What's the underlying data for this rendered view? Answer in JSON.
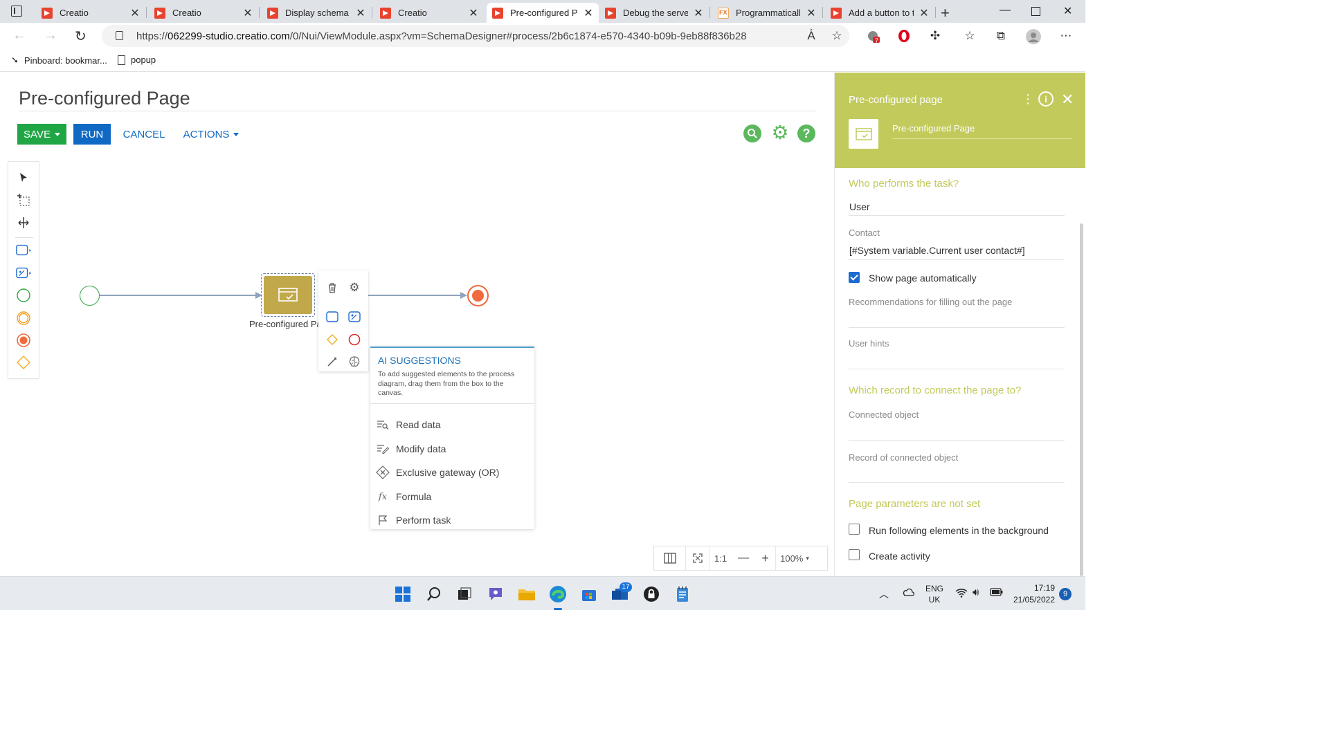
{
  "browser": {
    "tabs": [
      {
        "title": "Creatio",
        "icon": "creatio-favicon"
      },
      {
        "title": "Creatio",
        "icon": "creatio-favicon"
      },
      {
        "title": "Display schema -",
        "icon": "creatio-favicon"
      },
      {
        "title": "Creatio",
        "icon": "creatio-favicon"
      },
      {
        "title": "Pre-configured Pa",
        "icon": "creatio-favicon",
        "active": true
      },
      {
        "title": "Debug the server",
        "icon": "creatio-favicon"
      },
      {
        "title": "Programmatically",
        "icon": "fx-favicon"
      },
      {
        "title": "Add a button to t",
        "icon": "creatio-favicon"
      }
    ],
    "fx_letters": "FX",
    "url_prefix": "https://",
    "url_host": "062299-studio.creatio.com",
    "url_path": "/0/Nui/ViewModule.aspx?vm=SchemaDesigner#process/2b6c1874-e570-4340-b09b-9eb88f836b28",
    "extension_badge": "7",
    "bookmarks": [
      {
        "label": "Pinboard: bookmar...",
        "icon": "pin-icon"
      },
      {
        "label": "popup",
        "icon": "page-icon"
      }
    ]
  },
  "page": {
    "title": "Pre-configured Page",
    "toolbar": {
      "save_label": "SAVE",
      "run_label": "RUN",
      "cancel_label": "CANCEL",
      "actions_label": "ACTIONS"
    }
  },
  "canvas": {
    "task_label": "Pre-configured Page",
    "ai": {
      "title": "AI SUGGESTIONS",
      "description": "To add suggested elements to the process diagram, drag them from the box to the canvas.",
      "items": [
        {
          "label": "Read data",
          "icon": "read-data-icon"
        },
        {
          "label": "Modify data",
          "icon": "modify-data-icon"
        },
        {
          "label": "Exclusive gateway (OR)",
          "icon": "exclusive-gateway-icon"
        },
        {
          "label": "Formula",
          "icon": "formula-icon"
        },
        {
          "label": "Perform task",
          "icon": "flag-icon"
        }
      ]
    },
    "zoom": {
      "one_to_one": "1:1",
      "minus": "—",
      "plus": "+",
      "level": "100%"
    }
  },
  "panel": {
    "header_title": "Pre-configured page",
    "element_name": "Pre-configured Page",
    "who_performs_title": "Who performs the task?",
    "performer_value": "User",
    "contact_label": "Contact",
    "contact_value": "[#System variable.Current user contact#]",
    "show_page_label": "Show page automatically",
    "show_page_checked": true,
    "recommendations_label": "Recommendations for filling out the page",
    "user_hints_label": "User hints",
    "which_record_title": "Which record to connect the page to?",
    "connected_object_label": "Connected object",
    "record_connected_label": "Record of connected object",
    "page_params_title": "Page parameters are not set",
    "run_background_label": "Run following elements in the background",
    "run_background_checked": false,
    "create_activity_label": "Create activity",
    "create_activity_checked": false
  },
  "taskbar": {
    "lang_line1": "ENG",
    "lang_line2": "UK",
    "time": "17:19",
    "date": "21/05/2022",
    "notification_count": "9",
    "store_badge": "17"
  },
  "colors": {
    "accent_green": "#21a645",
    "run_blue": "#0f69c4",
    "panel_header": "#c2ca5c",
    "task_fill": "#c1a84a",
    "end_event": "#f06a3c",
    "start_event": "#37a845"
  }
}
